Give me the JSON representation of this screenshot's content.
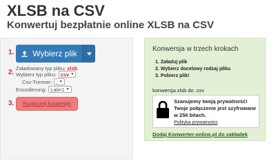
{
  "header": {
    "title": "XLSB na CSV",
    "subtitle": "Konwertuj bezpłatnie online XLSB na CSV"
  },
  "left": {
    "step1": "1.",
    "step2": "2.",
    "step3": "3.",
    "choose_file_label": "Wybierz plik",
    "loaded_label": "Załadowany typ pliku:",
    "loaded_value": "xlsb",
    "choose_type_label": "Wybierz typ pliku:",
    "choose_type_value": "csv",
    "separator_label": "Csv-Trenner:",
    "separator_value": ";",
    "encoding_label": "Encodierung:",
    "encoding_value": "Latin1",
    "convert_label": "Rozpocznij konwersję!"
  },
  "right": {
    "title": "Konwersja w trzech krokach",
    "steps": [
      "1. Załaduj plik",
      "2. Wybierz docelowy rodzaj pliku",
      "3. Pobierz plik!"
    ],
    "conversion_caption": "konwersja.xlsb do .csv",
    "privacy_text": "Szanujemy twoją prywatność! Twoje połączenie jest szyfrowane w 256 bitach.",
    "privacy_link": "Polityka prywatności",
    "bookmark_link": "Dodaj Konwerter-online.pl do zakładek"
  },
  "colors": {
    "primary": "#337ab7",
    "step_red": "#d9262b",
    "convert_button": "#f07b7b",
    "right_panel_bg": "#e3f0d5"
  },
  "icons": [
    "upload-icon",
    "caret-down-icon",
    "lock-icon"
  ]
}
